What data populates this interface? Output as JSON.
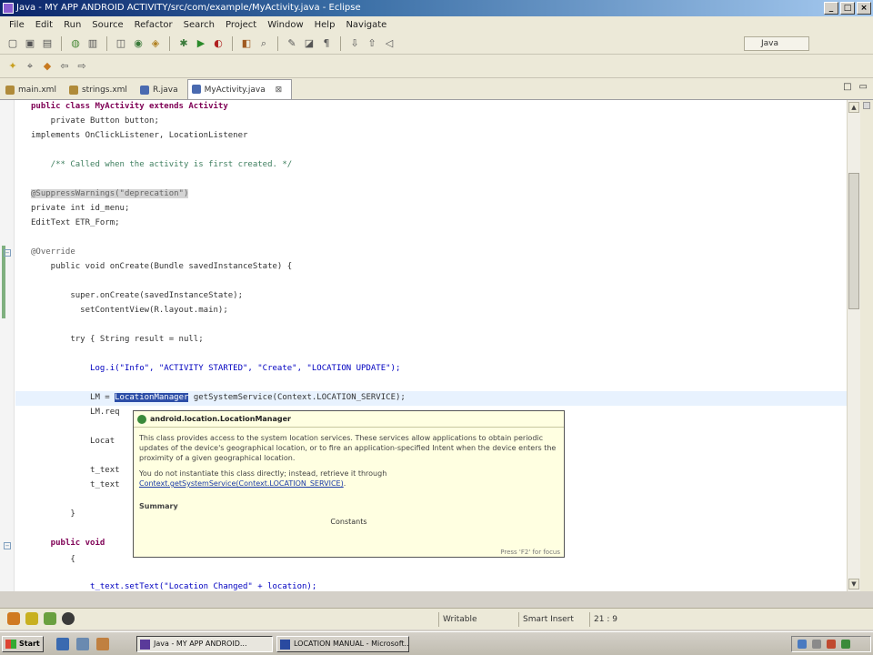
{
  "window": {
    "title": "Java - MY APP ANDROID ACTIVITY/src/com/example/MyActivity.java - Eclipse"
  },
  "menu": [
    "File",
    "Edit",
    "Run",
    "Source",
    "Refactor",
    "Search",
    "Project",
    "Window",
    "Help",
    "Navigate"
  ],
  "perspective": {
    "label": "Java"
  },
  "tabs": [
    {
      "label": "main.xml",
      "active": false
    },
    {
      "label": "strings.xml",
      "active": false
    },
    {
      "label": "R.java",
      "active": false
    },
    {
      "label": "MyActivity.java",
      "active": true
    }
  ],
  "editor_controls": [
    "□",
    "▭"
  ],
  "code": [
    {
      "kind": "decl",
      "text": "public class MyActivity extends Activity"
    },
    {
      "kind": "decl",
      "text": "    private Button button;"
    },
    {
      "kind": "decl",
      "text": "implements OnClickListener, LocationListener"
    },
    {
      "kind": "comment",
      "text": "    /** Called when the activity is first created. */"
    },
    {
      "kind": "annot",
      "text": "@SuppressWarnings(\"deprecation\")"
    },
    {
      "kind": "plain",
      "text": "private int id_menu;"
    },
    {
      "kind": "plain",
      "text": "EditText ETR_Form;"
    },
    {
      "kind": "annot",
      "text": "@Override"
    },
    {
      "kind": "plain",
      "text": "    public void onCreate(Bundle savedInstanceState) {"
    },
    {
      "kind": "plain",
      "text": "        super.onCreate(savedInstanceState);"
    },
    {
      "kind": "plain",
      "text": "          setContentView(R.layout.main);"
    },
    {
      "kind": "plain",
      "text": "        try { String result = null;"
    },
    {
      "kind": "plain",
      "text": "            Log.i(\"Info\", \"ACTIVITY STARTED\", \"Create\", \"LOCATION UPDATE\");"
    },
    {
      "kind": "plain",
      "text": "            LM = ",
      "sel": "LocationManager",
      "after": " getSystemService(Context.LOCATION_SERVICE);"
    },
    {
      "kind": "plain",
      "text": "            LM.req"
    },
    {
      "kind": "plain",
      "text": "            Locat"
    },
    {
      "kind": "plain",
      "text": "            t_text"
    },
    {
      "kind": "plain",
      "text": "            t_text"
    },
    {
      "kind": "plain",
      "text": "        }"
    },
    {
      "kind": "plain",
      "text": "    public void"
    },
    {
      "kind": "plain",
      "text": "        {"
    },
    {
      "kind": "plain",
      "text": "            t_text.setText(\"Location Changed\" + location);"
    }
  ],
  "javadoc": {
    "header": "android.location.LocationManager",
    "para1": "This class provides access to the system location services. These services allow applications to obtain periodic updates of the device's geographical location, or to fire an application-specified Intent when the device enters the proximity of a given geographical location.",
    "para2_prefix": "You do not instantiate this class directly; instead, retrieve it through ",
    "para2_link": "Context.getSystemService(Context.LOCATION_SERVICE)",
    "para2_suffix": ".",
    "summary": "Summary",
    "constants": "Constants",
    "footer": "Press 'F2' for focus"
  },
  "status": {
    "mode": "Writable",
    "insert": "Smart Insert",
    "position": "21 : 9"
  },
  "taskbar": {
    "start": "Start",
    "tasks": [
      {
        "label": "Java - MY APP ANDROID...",
        "active": true
      },
      {
        "label": "LOCATION MANUAL - Microsoft...",
        "active": false
      }
    ]
  }
}
